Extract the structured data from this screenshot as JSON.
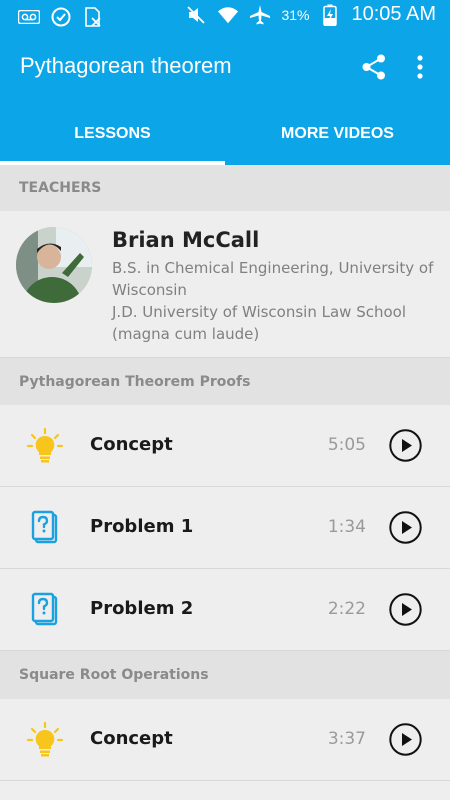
{
  "status_bar": {
    "battery_percent": "31%",
    "time": "10:05 AM",
    "icons": [
      "voicemail-icon",
      "check-circle-icon",
      "sim-x-icon",
      "mute-icon",
      "wifi-icon",
      "airplane-icon",
      "battery-charging-icon"
    ]
  },
  "app_bar": {
    "title": "Pythagorean theorem",
    "actions": [
      "share-icon",
      "more-vert-icon"
    ]
  },
  "tabs": [
    {
      "label": "LESSONS",
      "selected": true
    },
    {
      "label": "MORE VIDEOS",
      "selected": false
    }
  ],
  "teachers": {
    "header": "TEACHERS",
    "name": "Brian McCall",
    "bio": [
      "B.S. in Chemical Engineering, University of Wisconsin",
      "J.D. University of Wisconsin Law School (magna cum laude)"
    ]
  },
  "sections": [
    {
      "title": "Pythagorean Theorem Proofs",
      "items": [
        {
          "type": "concept",
          "icon": "lightbulb-icon",
          "label": "Concept",
          "duration": "5:05"
        },
        {
          "type": "problem",
          "icon": "question-cards-icon",
          "label": "Problem 1",
          "duration": "1:34"
        },
        {
          "type": "problem",
          "icon": "question-cards-icon",
          "label": "Problem 2",
          "duration": "2:22"
        }
      ]
    },
    {
      "title": "Square Root Operations",
      "items": [
        {
          "type": "concept",
          "icon": "lightbulb-icon",
          "label": "Concept",
          "duration": "3:37"
        }
      ]
    }
  ],
  "colors": {
    "primary": "#0ba5e8",
    "background": "#eeeeee",
    "section_header_bg": "#e2e2e2",
    "bulb": "#f7c51c",
    "problem_icon": "#1aa1e0"
  }
}
